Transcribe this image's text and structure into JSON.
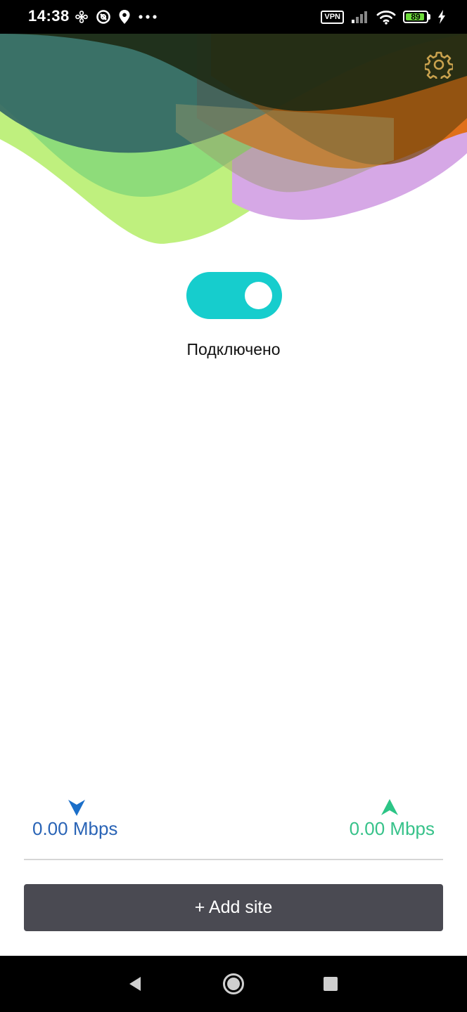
{
  "status_bar": {
    "time": "14:38",
    "left_icons": [
      "fan-icon",
      "blocked-icon",
      "location-pin-icon",
      "more-dots-icon"
    ],
    "vpn_label": "VPN",
    "battery_level": "89",
    "right_icons": [
      "signal-icon",
      "wifi-icon",
      "battery-icon",
      "charging-bolt-icon"
    ]
  },
  "header": {
    "settings_icon": "gear-icon",
    "colors": {
      "teal_dark": "#2c5a63",
      "green": "#8edc7a",
      "lime": "#bff07e",
      "orange": "#e0701a",
      "purple": "#d6a8e6",
      "dark_overlay": "#1e2a14"
    }
  },
  "connection": {
    "toggle_on": true,
    "toggle_color": "#16cdcd",
    "status_text": "Подключено"
  },
  "speeds": {
    "download_icon": "arrow-down-icon",
    "download_text": "0.00 Mbps",
    "download_color": "#2a64b6",
    "upload_icon": "arrow-up-icon",
    "upload_text": "0.00 Mbps",
    "upload_color": "#37c28a"
  },
  "actions": {
    "add_site_label": "+ Add site"
  },
  "nav_bar": {
    "icons": [
      "back-icon",
      "home-icon",
      "recents-icon"
    ]
  }
}
